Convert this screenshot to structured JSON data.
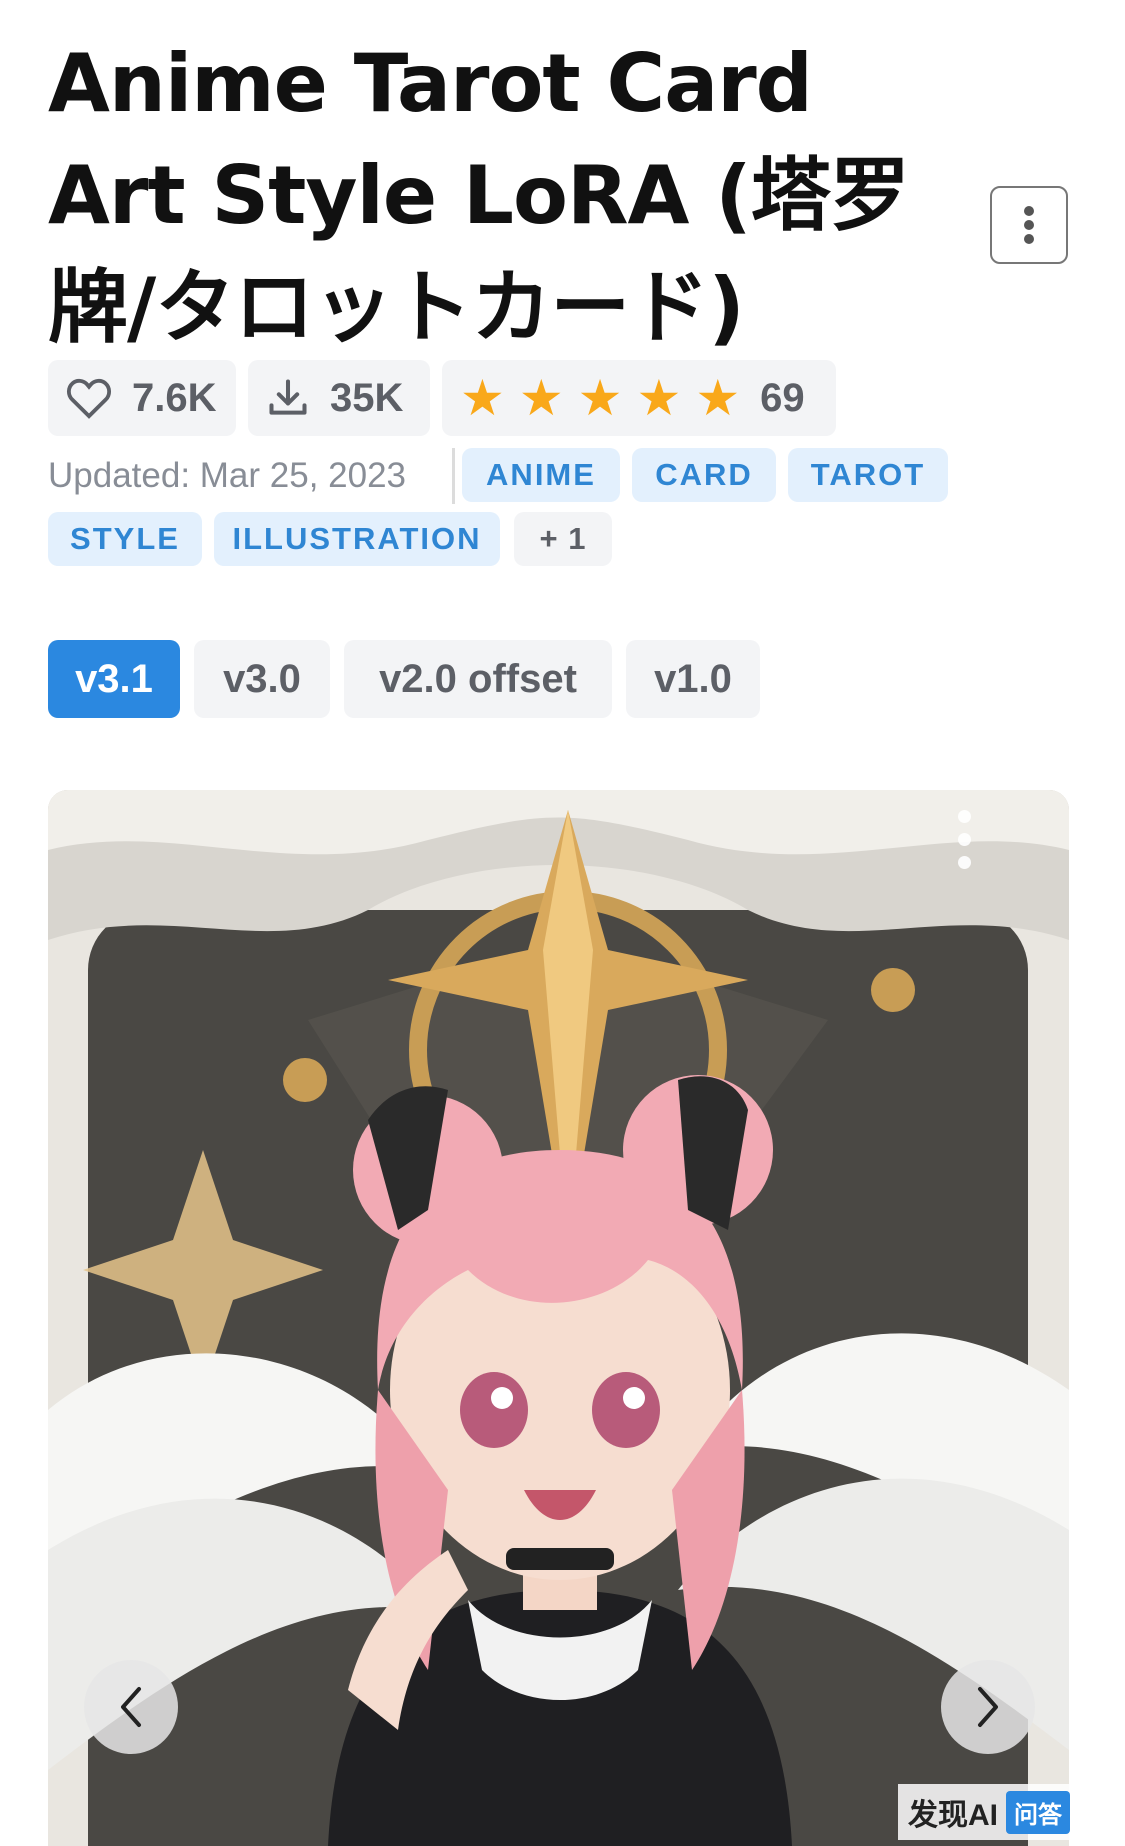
{
  "model": {
    "title": "Anime Tarot Card Art Style LoRA (塔罗牌/タロットカード)"
  },
  "stats": {
    "likes": "7.6K",
    "downloads": "35K",
    "rating_stars": 5,
    "rating_count": "69"
  },
  "meta": {
    "updated": "Updated: Mar 25, 2023"
  },
  "tags": [
    "ANIME",
    "CARD",
    "TAROT",
    "STYLE",
    "ILLUSTRATION"
  ],
  "tags_more": "+ 1",
  "versions": [
    "v3.1",
    "v3.0",
    "v2.0 offset",
    "v1.0"
  ],
  "active_version": "v3.1",
  "icons": {
    "more": "vertical-dots-icon",
    "like": "heart-icon",
    "download": "download-icon",
    "star": "star-icon",
    "prev": "chevron-left-icon",
    "next": "chevron-right-icon"
  },
  "colors": {
    "accent": "#2b88e0",
    "tag_bg": "#e3f0fd",
    "tag_text": "#2f86d3",
    "star": "#f9a81a"
  },
  "watermark": {
    "site": "发现AI",
    "badge": "问答"
  }
}
